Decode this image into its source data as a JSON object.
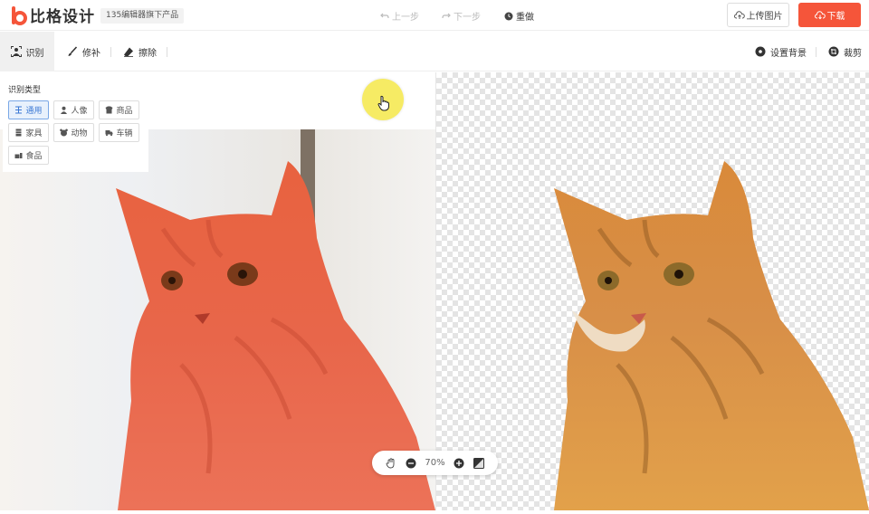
{
  "header": {
    "logo_text": "比格设计",
    "sub_brand": "135编辑器旗下产品",
    "undo_label": "上一步",
    "redo_label": "下一步",
    "redo_all_label": "重做",
    "upload_label": "上传图片",
    "download_label": "下载"
  },
  "toolbar": {
    "recognize_label": "识别",
    "repair_label": "修补",
    "erase_label": "擦除",
    "set_background_label": "设置背景",
    "crop_label": "裁剪"
  },
  "recognition": {
    "title": "识别类型",
    "types": [
      {
        "label": "通用",
        "icon": "general-icon",
        "active": true
      },
      {
        "label": "人像",
        "icon": "person-icon",
        "active": false
      },
      {
        "label": "商品",
        "icon": "product-icon",
        "active": false
      },
      {
        "label": "家具",
        "icon": "furniture-icon",
        "active": false
      },
      {
        "label": "动物",
        "icon": "animal-icon",
        "active": false
      },
      {
        "label": "车辆",
        "icon": "vehicle-icon",
        "active": false
      },
      {
        "label": "食品",
        "icon": "food-icon",
        "active": false
      }
    ]
  },
  "zoom": {
    "level": "70%"
  },
  "colors": {
    "accent": "#f5553a",
    "active_blue": "#3a78d4",
    "cursor_highlight": "#f5e84a"
  }
}
